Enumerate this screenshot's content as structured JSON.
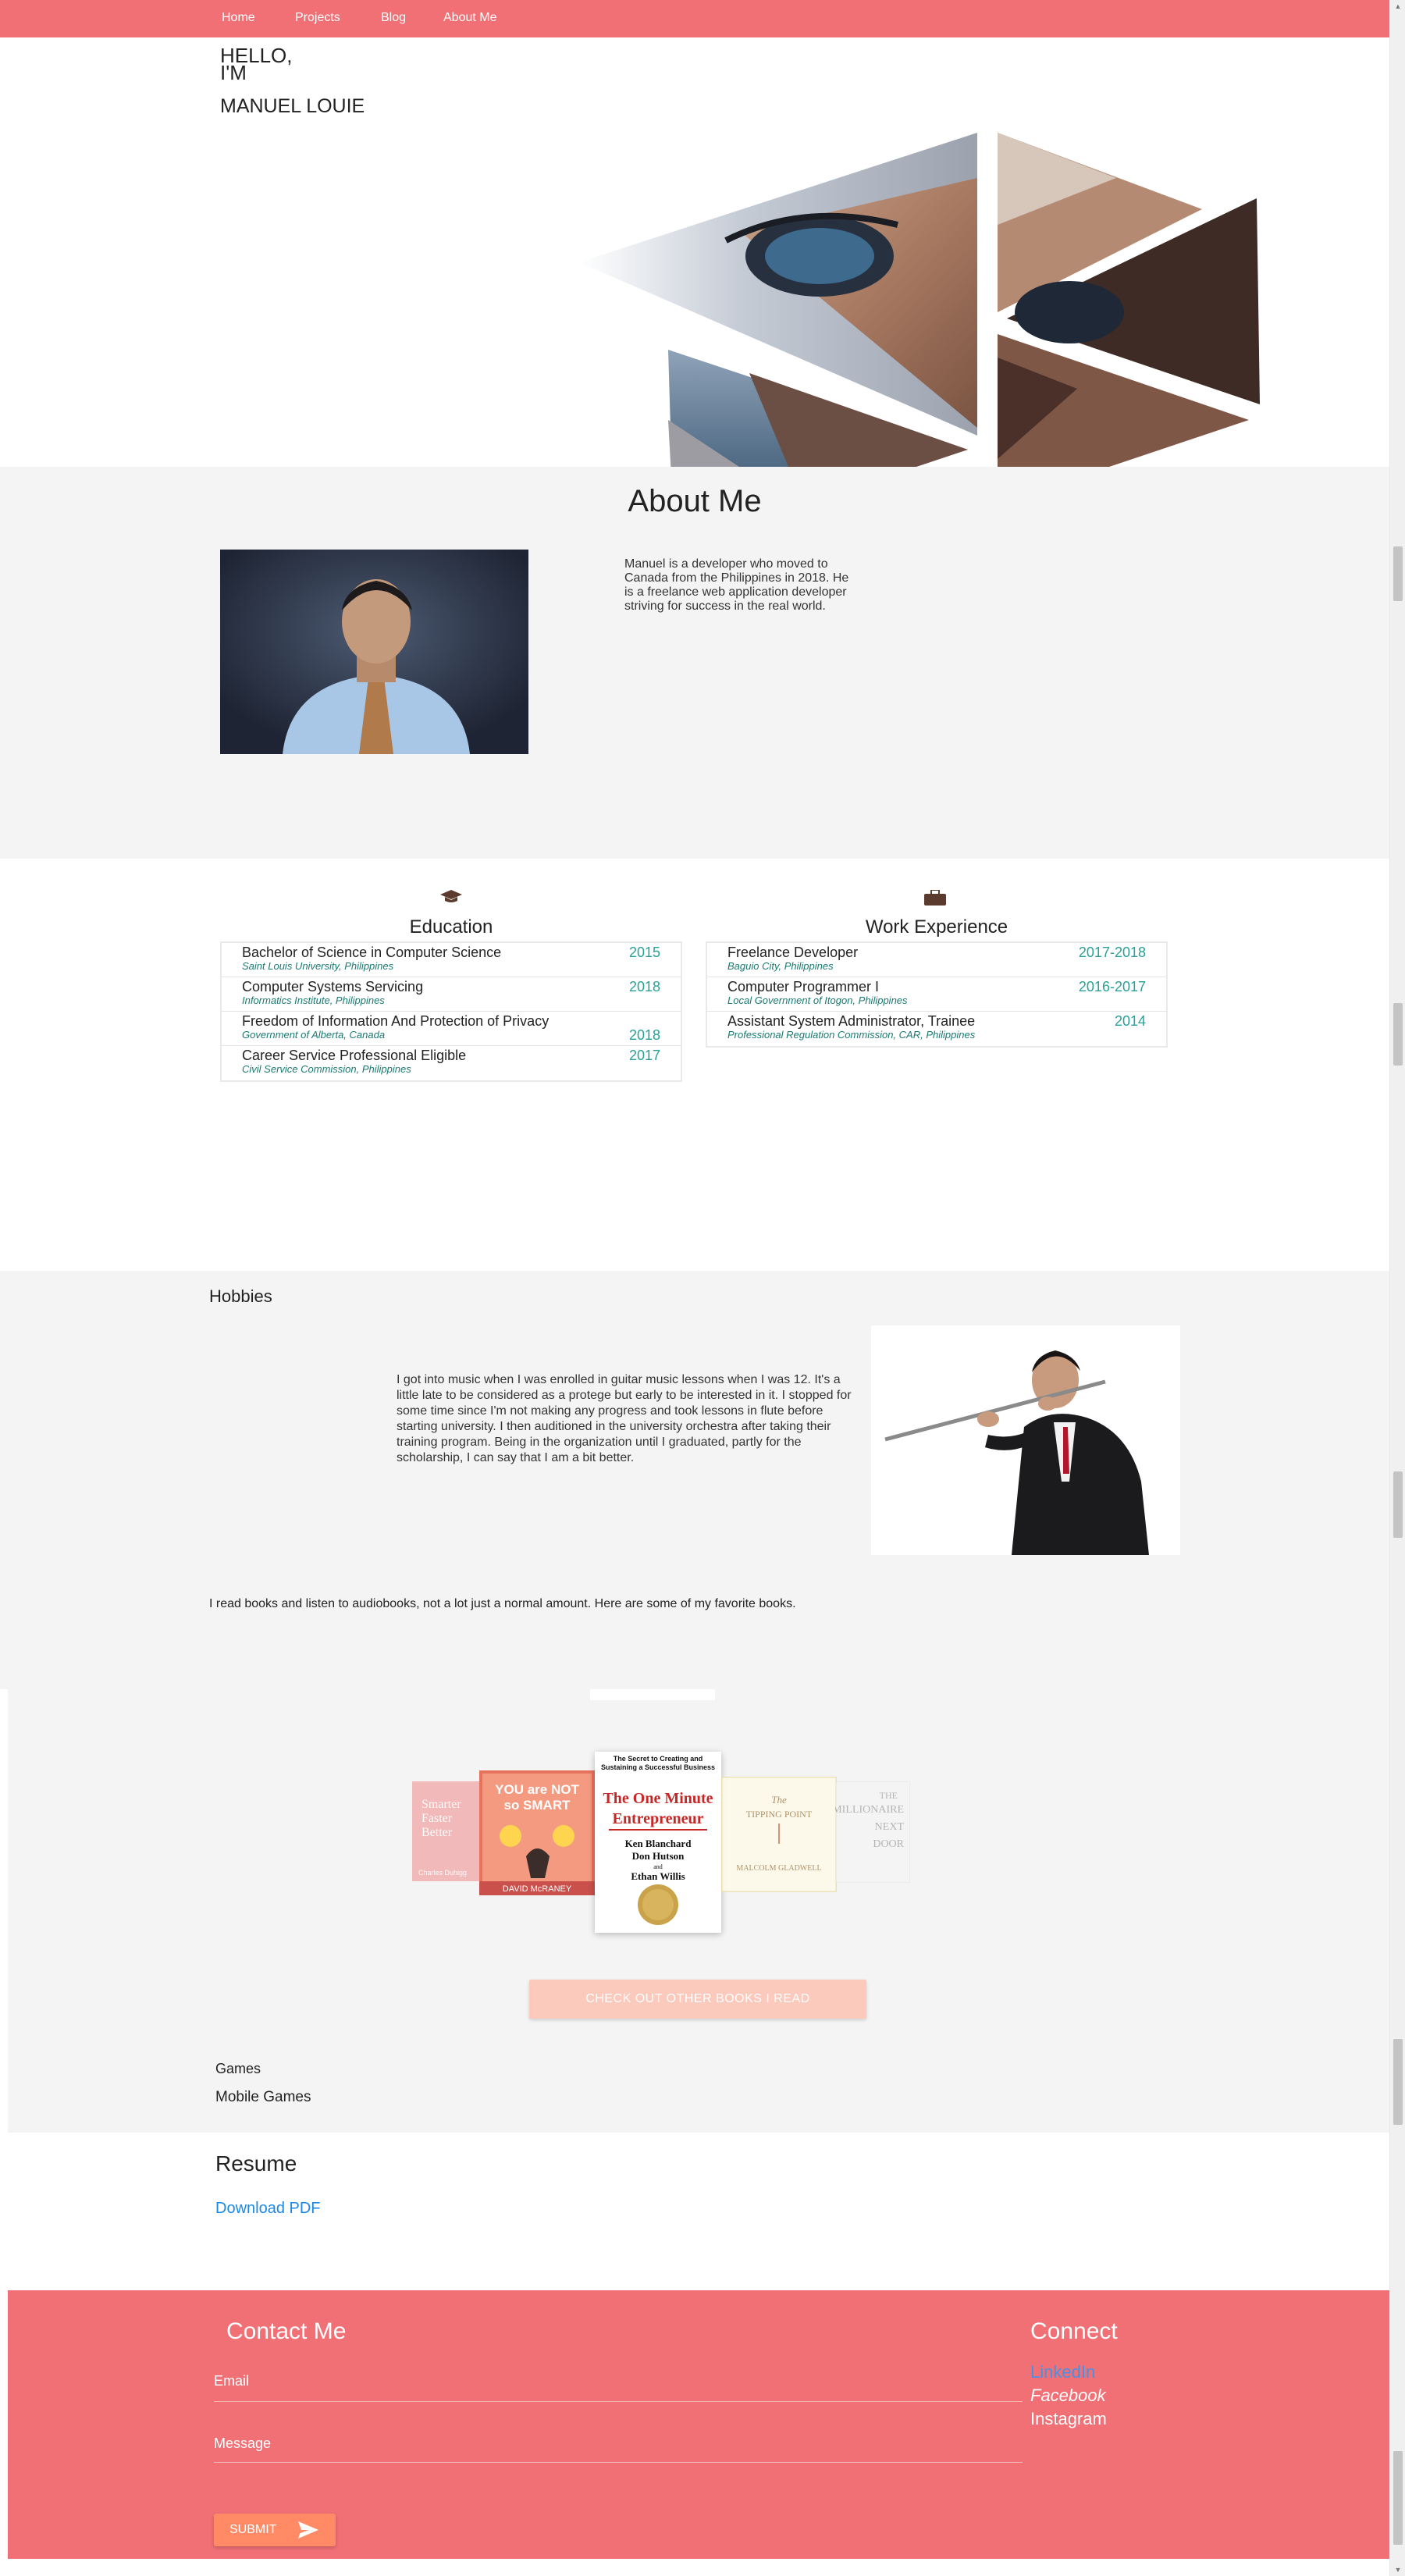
{
  "nav": {
    "items": [
      "Home",
      "Projects",
      "Blog",
      "About Me"
    ]
  },
  "hero": {
    "greeting_1": "HELLO,",
    "greeting_2": "I'M",
    "name": "MANUEL LOUIE"
  },
  "about": {
    "title": "About Me",
    "text": "Manuel is a developer who moved to Canada from the Philippines in 2018. He is a freelance web application developer striving for success in the real world."
  },
  "education": {
    "icon": "graduation-cap-icon",
    "title": "Education",
    "items": [
      {
        "title": "Bachelor of Science in Computer Science",
        "sub": "Saint Louis University, Philippines",
        "year": "2015"
      },
      {
        "title": "Computer Systems Servicing",
        "sub": "Informatics Institute, Philippines",
        "year": "2018"
      },
      {
        "title": "Freedom of Information And Protection of Privacy",
        "sub": "Government of Alberta, Canada",
        "year": "2018"
      },
      {
        "title": "Career Service Professional Eligible",
        "sub": "Civil Service Commission, Philippines",
        "year": "2017"
      }
    ]
  },
  "work": {
    "icon": "briefcase-icon",
    "title": "Work Experience",
    "items": [
      {
        "title": "Freelance Developer",
        "sub": "Baguio City, Philippines",
        "year": "2017-2018"
      },
      {
        "title": "Computer Programmer I",
        "sub": "Local Government of Itogon, Philippines",
        "year": "2016-2017"
      },
      {
        "title": "Assistant System Administrator, Trainee",
        "sub": "Professional Regulation Commission, CAR, Philippines",
        "year": "2014"
      }
    ]
  },
  "hobbies": {
    "title": "Hobbies",
    "music_text": "I got into music when I was enrolled in guitar music lessons when I was 12. It's a little late to be considered as a protege but early to be interested in it. I stopped for some time since I'm not making any progress and took lessons in flute before starting university. I then auditioned in the university orchestra after taking their training program. Being in the organization until I graduated, partly for the scholarship, I can say that I am a bit better.",
    "books_text": "I read books and listen to audiobooks, not a lot just a normal amount. Here are some of my favorite books."
  },
  "books": {
    "covers": [
      {
        "lines": [
          "Smarter",
          "Faster",
          "Better"
        ],
        "author": "Charles Duhigg"
      },
      {
        "lines": [
          "YOU are NOT",
          "so SMART"
        ],
        "author": "DAVID McRANEY"
      },
      {
        "tagline": "The Secret to Creating and Sustaining a Successful Business",
        "title_1": "The One Minute",
        "title_2": "Entrepreneur",
        "authors": [
          "Ken Blanchard",
          "Don Hutson",
          "and",
          "Ethan Willis"
        ]
      },
      {
        "lines": [
          "The",
          "TIPPING POINT"
        ],
        "author": "MALCOLM GLADWELL"
      },
      {
        "lines": [
          "THE",
          "MILLIONAIRE",
          "NEXT",
          "DOOR"
        ]
      }
    ],
    "button": "CHECK OUT OTHER BOOKS I READ",
    "games": "Games",
    "mobile_games": "Mobile Games"
  },
  "resume": {
    "title": "Resume",
    "link": "Download PDF"
  },
  "contact": {
    "title": "Contact Me",
    "email_label": "Email",
    "message_label": "Message",
    "submit": "SUBMIT"
  },
  "connect": {
    "title": "Connect",
    "links": [
      "LinkedIn",
      "Facebook",
      "Instagram"
    ],
    "link_colors": [
      "#4a90e2",
      "#ffffff",
      "#ffffff"
    ]
  },
  "colors": {
    "accent": "#f07075",
    "teal": "#2aa198",
    "button": "#ff8a65",
    "link": "#1e88e5"
  }
}
